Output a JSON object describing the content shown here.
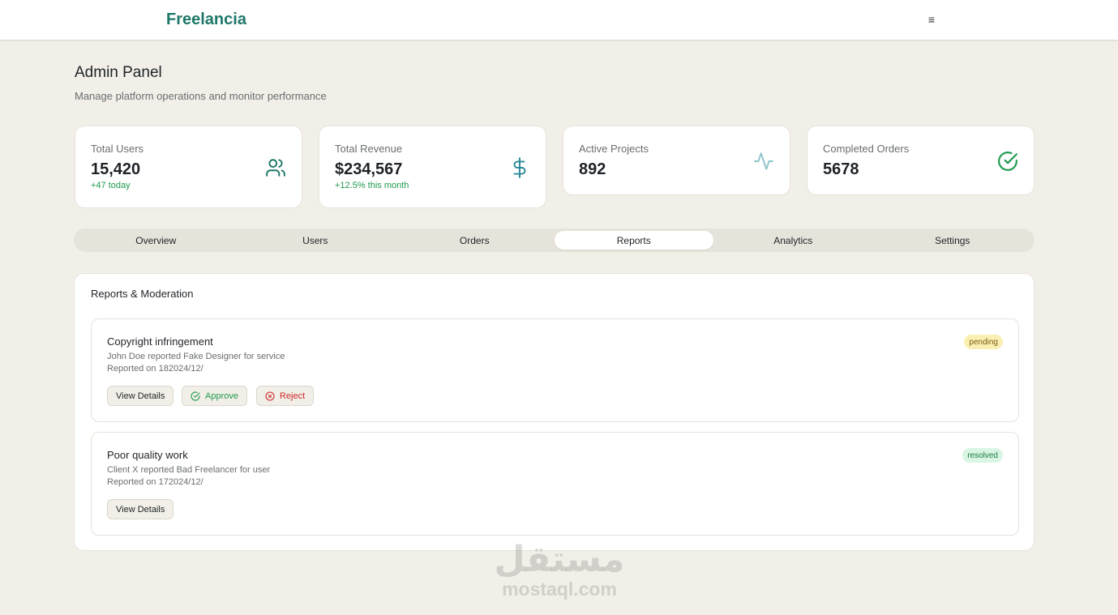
{
  "header": {
    "brand": "Freelancia",
    "menu_icon": "≡"
  },
  "page": {
    "title": "Admin Panel",
    "subtitle": "Manage platform operations and monitor performance"
  },
  "stats": [
    {
      "label": "Total Users",
      "value": "15,420",
      "delta": "+47 today",
      "icon": "users-icon",
      "icon_color": "#1e7769"
    },
    {
      "label": "Total Revenue",
      "value": "$234,567",
      "delta": "+12.5% this month",
      "icon": "dollar-icon",
      "icon_color": "#2b8a99"
    },
    {
      "label": "Active Projects",
      "value": "892",
      "icon": "activity-icon",
      "icon_color": "#8cc4c9"
    },
    {
      "label": "Completed Orders",
      "value": "5678",
      "icon": "check-circle-icon",
      "icon_color": "#1f9a4f"
    }
  ],
  "tabs": [
    {
      "label": "Overview",
      "active": false
    },
    {
      "label": "Users",
      "active": false
    },
    {
      "label": "Orders",
      "active": false
    },
    {
      "label": "Reports",
      "active": true
    },
    {
      "label": "Analytics",
      "active": false
    },
    {
      "label": "Settings",
      "active": false
    }
  ],
  "panel": {
    "title": "Reports & Moderation",
    "reports": [
      {
        "title": "Copyright infringement",
        "description": "John Doe reported Fake Designer for service",
        "date": "Reported on 182024/12/",
        "status": "pending",
        "actions": {
          "view": "View Details",
          "approve": "Approve",
          "reject": "Reject"
        }
      },
      {
        "title": "Poor quality work",
        "description": "Client X reported Bad Freelancer for user",
        "date": "Reported on 172024/12/",
        "status": "resolved",
        "actions": {
          "view": "View Details"
        }
      }
    ]
  },
  "watermark": {
    "arabic": "مستقل",
    "latin": "mostaql.com"
  },
  "colors": {
    "accent": "#1e7769",
    "background": "#f1efe7",
    "success": "#1f9a4f",
    "danger": "#cc2a2a"
  }
}
